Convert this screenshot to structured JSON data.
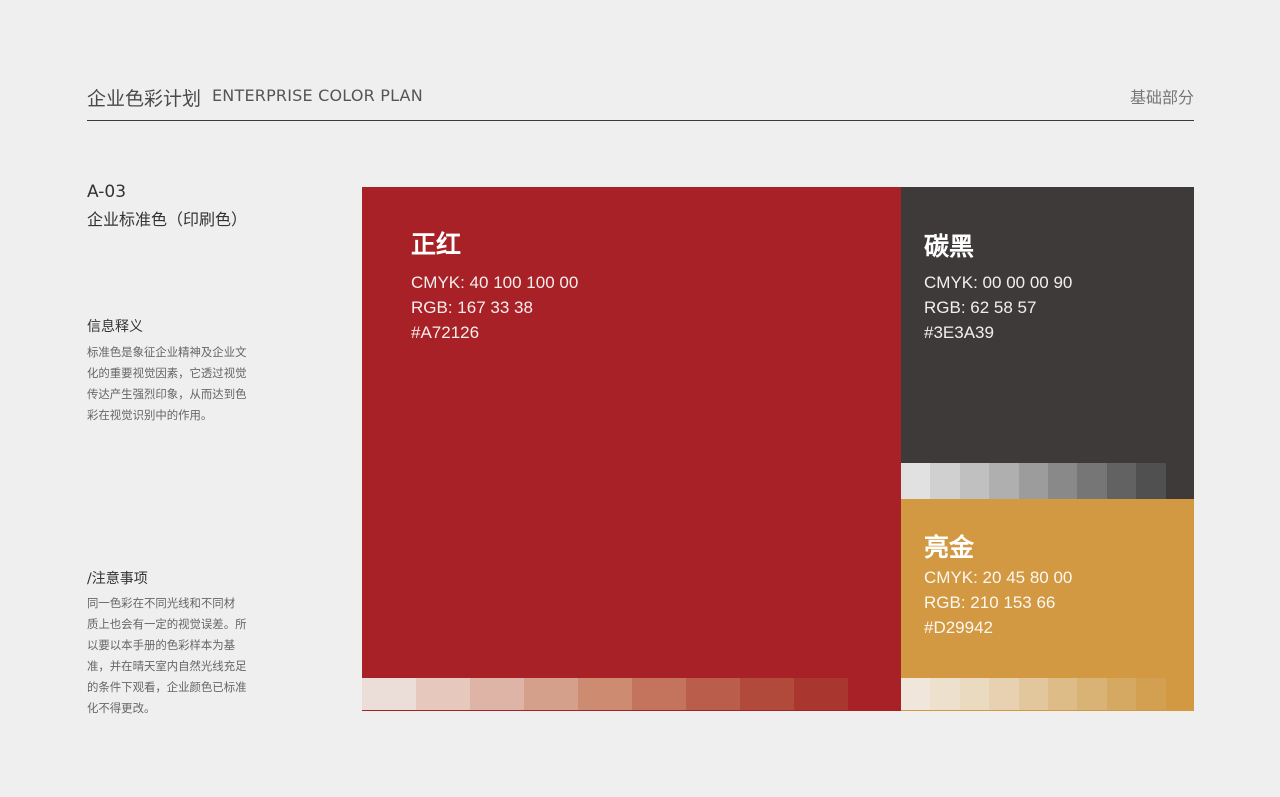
{
  "header": {
    "title_cn": "企业色彩计划",
    "title_en": "ENTERPRISE COLOR PLAN",
    "section": "基础部分"
  },
  "page": {
    "code": "A-03",
    "subtitle": "企业标准色（印刷色）"
  },
  "info": {
    "title": "信息释义",
    "lines": [
      "标准色是象征企业精神及企业文",
      "化的重要视觉因素，它透过视觉",
      "传达产生强烈印象，从而达到色",
      "彩在视觉识别中的作用。"
    ]
  },
  "notes": {
    "title": "/注意事项",
    "lines": [
      "同一色彩在不同光线和不同材",
      "质上也会有一定的视觉误差。所",
      "以要以本手册的色彩样本为基",
      "准，并在晴天室内自然光线充足",
      "的条件下观看，企业颜色已标准",
      "化不得更改。"
    ]
  },
  "colors": {
    "red": {
      "name": "正红",
      "cmyk": "CMYK: 40  100  100  00",
      "rgb": "RGB:  167  33  38",
      "hex": "#A72126",
      "color": "#a72126"
    },
    "black": {
      "name": "碳黑",
      "cmyk": "CMYK:  00  00  00  90",
      "rgb": "RGB:  62  58  57",
      "hex": "#3E3A39",
      "color": "#3e3a39"
    },
    "gold": {
      "name": "亮金",
      "cmyk": "CMYK:  20  45  80  00",
      "rgb": "RGB:  210  153  66",
      "hex": "#D29942",
      "color": "#d29942"
    }
  },
  "tints": {
    "red": [
      "#ebddd8",
      "#e6c9bc",
      "#ddb4a5",
      "#d49f8b",
      "#cd8b72",
      "#c4735c",
      "#ba5e4b",
      "#b24a3c",
      "#aa3630"
    ],
    "black": [
      "#e1e1e1",
      "#d0d0d0",
      "#c0c0c0",
      "#afafaf",
      "#9c9c9c",
      "#898989",
      "#767676",
      "#626262",
      "#505050"
    ],
    "gold": [
      "#f1e6dc",
      "#ede0cd",
      "#eadac0",
      "#e7d1b0",
      "#e2c79d",
      "#ddbc87",
      "#d9b275",
      "#d6a963",
      "#d3a052"
    ]
  }
}
